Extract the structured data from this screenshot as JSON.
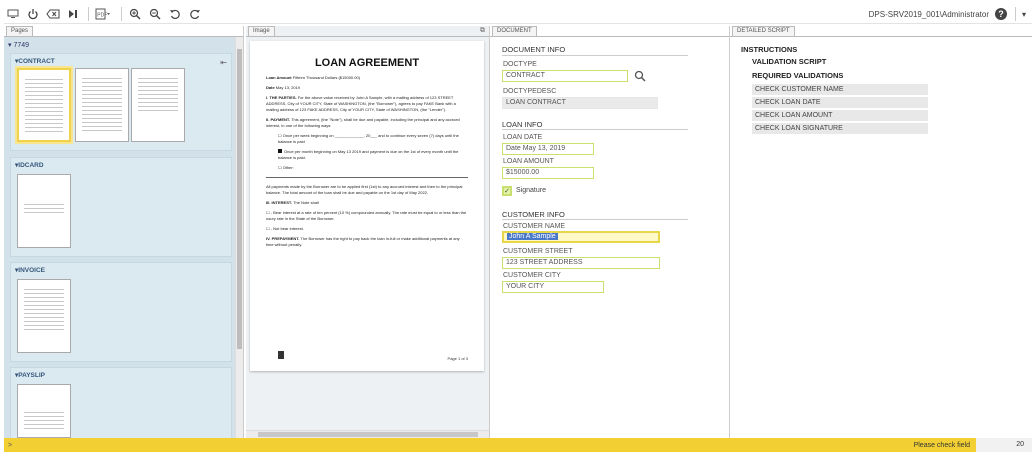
{
  "toolbar": {
    "icons": [
      "screen-icon",
      "power-icon",
      "clear-icon",
      "skip-icon",
      "pdf-icon",
      "zoom-in-icon",
      "zoom-out-icon",
      "rotate-left-icon",
      "rotate-right-icon"
    ],
    "server_user": "DPS-SRV2019_001\\Administrator",
    "help": "?",
    "menu": "▾"
  },
  "pages_panel": {
    "tab": "Pages",
    "batch": "7749",
    "groups": [
      {
        "label": "CONTRACT",
        "thumbs": 3
      },
      {
        "label": "IDCARD",
        "thumbs": 1
      },
      {
        "label": "INVOICE",
        "thumbs": 1
      },
      {
        "label": "PAYSLIP",
        "thumbs": 1
      }
    ]
  },
  "image_panel": {
    "tab": "Image",
    "doc": {
      "title": "LOAN AGREEMENT",
      "amount_label": "Loan Amount",
      "amount": "Fifteen Thousand Dollars ($15000.00)",
      "date_label": "Date",
      "date": "May 13, 2019",
      "p1_title": "I. THE PARTIES.",
      "p1": "For the above value received by John A Sample, with a mailing address of 123 STREET ADDRESS, City of YOUR CITY, State of WASHINGTON, (the \"Borrower\"), agrees to pay FAKE Bank with a mailing address of 123 FAKE ADDRESS, City of YOUR CITY, State of WASHINGTON, (the \"Lender\").",
      "p2_title": "II. PAYMENT.",
      "p2": "This agreement, (the \"Note\"), shall be due and payable, including the principal and any accrued interest, in one of the following ways:",
      "opt1": "☐ Once per week beginning on _____________, 20___ and to continue every seven (7) days until the balance is paid",
      "opt2": "Once per month beginning on May 13 2019 and payment is due on the 1st of every month until the balance is paid.",
      "opt3": "☐ Other:",
      "p2b": "All payments made by the Borrower are to be applied first (1st) to any accrued interest and then to the principal balance. The total amount of the loan shall be due and payable on the 1st day of May 2022.",
      "p3_title": "III. INTEREST.",
      "p3": "The Note shall",
      "opt4": "☐ - Bear interest at a rate of ten percent (10 %) compounded annually. The rate must be equal to or less than the usury rate in the State of the Borrower.",
      "opt5": "☐ - Not bear interest.",
      "p4_title": "IV. PREPAYMENT.",
      "p4": "The Borrower has the right to pay back the loan in-full or make additional payments at any time without penalty.",
      "footer": "Page 1 of 3"
    }
  },
  "document_panel": {
    "tab": "DOCUMENT",
    "doc_info_title": "DOCUMENT INFO",
    "doctype_label": "DOCTYPE",
    "doctype_value": "CONTRACT",
    "doctypedesc_label": "DOCTYPEDESC",
    "doctypedesc_value": "LOAN CONTRACT",
    "loan_info_title": "LOAN INFO",
    "loan_date_label": "LOAN DATE",
    "loan_date_value": "Date May 13, 2019",
    "loan_amount_label": "LOAN AMOUNT",
    "loan_amount_value": "$15000.00",
    "signature_label": "Signature",
    "signature_checked": true,
    "customer_info_title": "CUSTOMER INFO",
    "customer_name_label": "CUSTOMER NAME",
    "customer_name_value": "John A Sample",
    "customer_street_label": "CUSTOMER STREET",
    "customer_street_value": "123 STREET ADDRESS",
    "customer_city_label": "CUSTOMER CITY",
    "customer_city_value": "YOUR CITY"
  },
  "script_panel": {
    "tab": "DETAILED SCRIPT",
    "instructions": "INSTRUCTIONS",
    "validation_script": "VALIDATION SCRIPT",
    "required_validations": "REQUIRED VALIDATIONS",
    "checks": [
      "CHECK CUSTOMER NAME",
      "CHECK LOAN DATE",
      "CHECK LOAN AMOUNT",
      "CHECK LOAN SIGNATURE"
    ]
  },
  "status": {
    "arrow": ">",
    "message": "Please check field",
    "count": "20"
  },
  "colors": {
    "status_bar": "#f2d033",
    "field_border": "#c8e06d",
    "active_field": "#fff9c7",
    "selection": "#4a78c8",
    "pages_bg": "#d3e2ea"
  }
}
